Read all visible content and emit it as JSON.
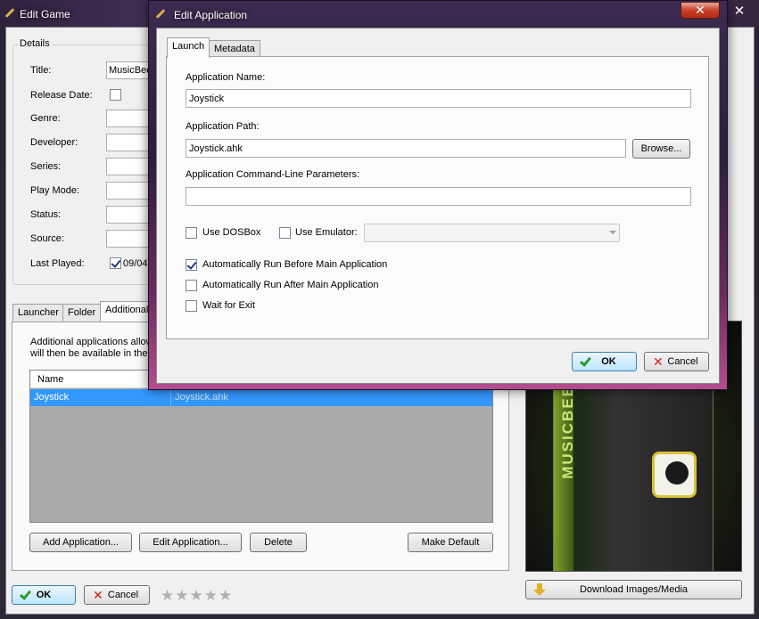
{
  "background_window": {
    "title": "Edit Game",
    "close_glyph": "✕",
    "details_label": "Details",
    "fields": {
      "title_label": "Title:",
      "title_value": "MusicBee",
      "release_date_label": "Release Date:",
      "genre_label": "Genre:",
      "developer_label": "Developer:",
      "series_label": "Series:",
      "play_mode_label": "Play Mode:",
      "status_label": "Status:",
      "source_label": "Source:",
      "last_played_label": "Last Played:",
      "last_played_value": "09/04"
    },
    "tabs": {
      "launcher": "Launcher",
      "folder": "Folder",
      "additional": "Additional"
    },
    "additional_desc_line1": "Additional applications allow",
    "additional_desc_line2": "will then be available in the",
    "apps_table": {
      "header_name": "Name",
      "rows": [
        {
          "name": "Joystick",
          "path": "Joystick.ahk"
        }
      ]
    },
    "buttons": {
      "add_application": "Add Application...",
      "edit_application": "Edit Application...",
      "delete": "Delete",
      "make_default": "Make Default",
      "download_media": "Download Images/Media",
      "ok": "OK",
      "cancel": "Cancel"
    },
    "cover_brand": "MUSICBEE",
    "rating_stars": "★★★★★"
  },
  "dialog": {
    "title": "Edit Application",
    "close_glyph": "✕",
    "tabs": {
      "launch": "Launch",
      "metadata": "Metadata"
    },
    "app_name_label": "Application Name:",
    "app_name_value": "Joystick",
    "app_path_label": "Application Path:",
    "app_path_value": "Joystick.ahk",
    "browse_label": "Browse...",
    "cmd_params_label": "Application Command-Line Parameters:",
    "cmd_params_value": "",
    "use_dosbox_label": "Use DOSBox",
    "use_emulator_label": "Use Emulator:",
    "auto_run_before_label": "Automatically Run Before Main Application",
    "auto_run_after_label": "Automatically Run After Main Application",
    "wait_for_exit_label": "Wait for Exit",
    "checkbox_state": {
      "use_dosbox": false,
      "use_emulator": false,
      "auto_run_before": true,
      "auto_run_after": false,
      "wait_for_exit": false
    },
    "ok_label": "OK",
    "cancel_label": "Cancel"
  }
}
